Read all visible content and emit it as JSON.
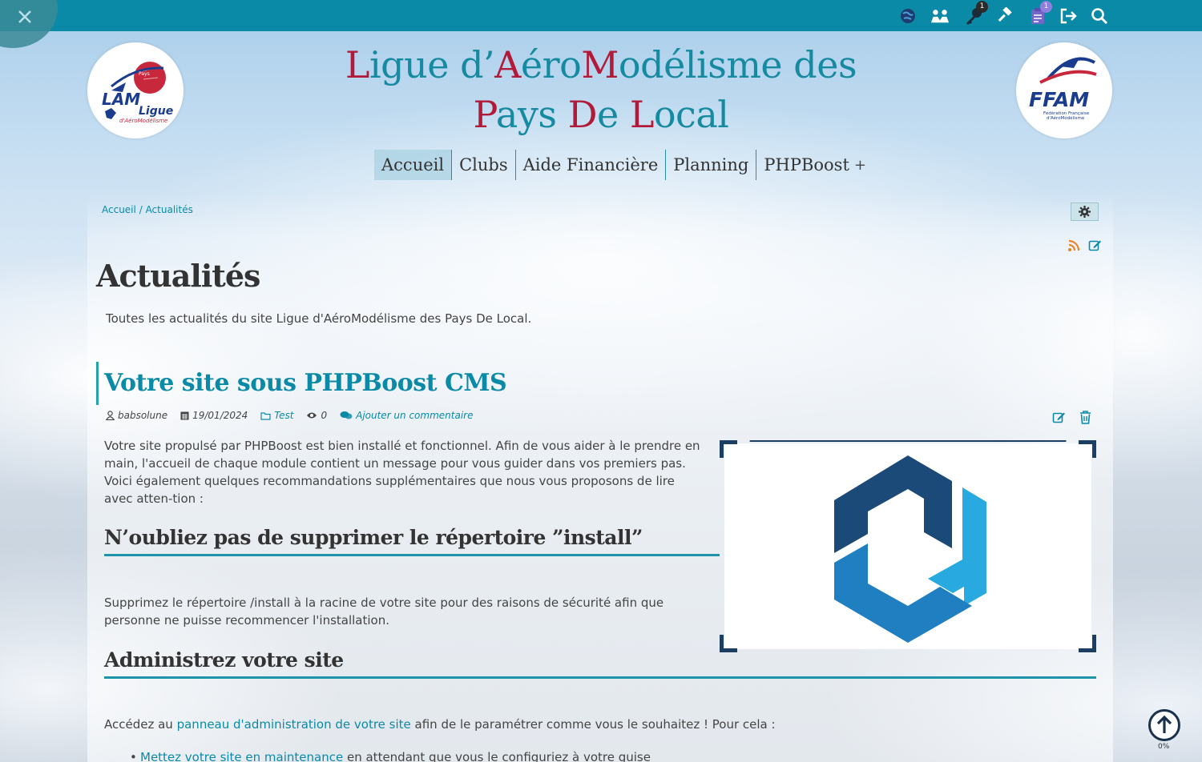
{
  "topbar": {
    "icons": [
      "world-icon",
      "users-icon",
      "key-icon",
      "gavel-icon",
      "clipboard-icon",
      "sign-out-icon",
      "search-icon"
    ],
    "key_badge": "1",
    "clipboard_badge": "1"
  },
  "logos": {
    "left": {
      "big": "LAM",
      "word": "Ligue",
      "sub": "d'AéroModélisme",
      "region": "Pays de la Loire"
    },
    "right": {
      "big": "FFAM",
      "sub1": "Fédération Française",
      "sub2": "d'AéroModélisme"
    }
  },
  "site": {
    "title_parts": [
      {
        "t": "L",
        "cap": true
      },
      {
        "t": "igue d’",
        "cap": false
      },
      {
        "t": "A",
        "cap": true
      },
      {
        "t": "éro",
        "cap": false
      },
      {
        "t": "M",
        "cap": true
      },
      {
        "t": "odélisme des",
        "cap": false
      }
    ],
    "title_parts2": [
      {
        "t": "P",
        "cap": true
      },
      {
        "t": "ays ",
        "cap": false
      },
      {
        "t": "D",
        "cap": true
      },
      {
        "t": "e ",
        "cap": false
      },
      {
        "t": "L",
        "cap": true
      },
      {
        "t": "ocal",
        "cap": false
      }
    ]
  },
  "nav": {
    "items": [
      "Accueil",
      "Clubs",
      "Aide Financière",
      "Planning",
      "PHPBoost"
    ],
    "active": "Accueil",
    "plus": "+"
  },
  "breadcrumb": {
    "home": "Accueil",
    "sep": "/",
    "current": "Actualités"
  },
  "page": {
    "title": "Actualités",
    "description": "Toutes les actualités du site Ligue d'AéroModélisme des Pays De Local."
  },
  "article": {
    "title": "Votre site sous PHPBoost CMS",
    "author": "babsolune",
    "date": "19/01/2024",
    "category": "Test",
    "views": "0",
    "comment_link": "Ajouter un commentaire",
    "intro": "Votre site propulsé par PHPBoost est bien installé et fonctionnel. Afin de vous aider à le prendre en main, l'accueil de chaque module contient un message pour vous guider dans vos premiers pas. Voici également quelques recommandations supplémentaires que nous vous proposons de lire avec atten-tion :",
    "h2_install": "N’oubliez pas de supprimer le répertoire ”install”",
    "install_text": "Supprimez le répertoire /install à la racine de votre site pour des raisons de sécurité afin que personne ne puisse recommencer l'installation.",
    "h2_admin": "Administrez votre site",
    "admin_text_before": "Accédez au ",
    "admin_link": "panneau d'administration de votre site",
    "admin_text_after": " afin de le paramétrer comme vous le souhaitez ! Pour cela :",
    "list_link": "Mettez votre site en maintenance",
    "list_text": " en attendant que vous le configuriez à votre guise"
  },
  "scroll": {
    "percent": "0%"
  },
  "colors": {
    "accent": "#0a8aa7",
    "brand_red": "#b21a3a",
    "topbar": "#0a8aa7"
  }
}
